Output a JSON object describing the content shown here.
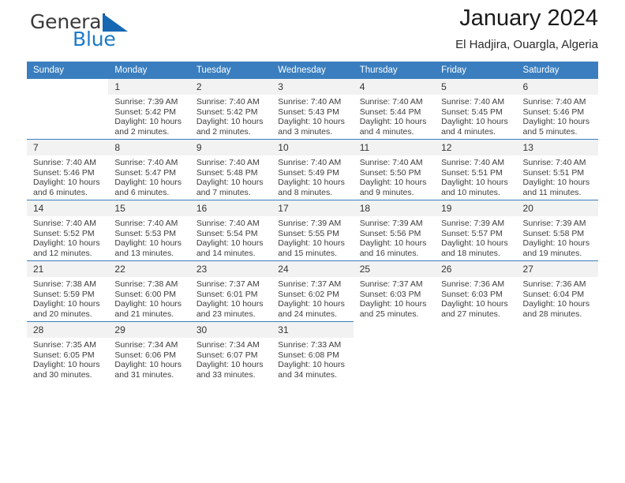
{
  "brand": {
    "word_one": "General",
    "word_two": "Blue",
    "logo_icon": "triangle-flag-icon",
    "accent_color": "#1668b3"
  },
  "header": {
    "title": "January 2024",
    "subtitle": "El Hadjira, Ouargla, Algeria"
  },
  "theme": {
    "header_blue": "#3a7ebf",
    "daynum_gray": "#f2f2f2",
    "text_color": "#3d3d3d"
  },
  "calendar": {
    "weekday_headers": [
      "Sunday",
      "Monday",
      "Tuesday",
      "Wednesday",
      "Thursday",
      "Friday",
      "Saturday"
    ],
    "weeks": [
      [
        {
          "blank": true
        },
        {
          "day": "1",
          "sunrise": "Sunrise: 7:39 AM",
          "sunset": "Sunset: 5:42 PM",
          "daylight": "Daylight: 10 hours and 2 minutes."
        },
        {
          "day": "2",
          "sunrise": "Sunrise: 7:40 AM",
          "sunset": "Sunset: 5:42 PM",
          "daylight": "Daylight: 10 hours and 2 minutes."
        },
        {
          "day": "3",
          "sunrise": "Sunrise: 7:40 AM",
          "sunset": "Sunset: 5:43 PM",
          "daylight": "Daylight: 10 hours and 3 minutes."
        },
        {
          "day": "4",
          "sunrise": "Sunrise: 7:40 AM",
          "sunset": "Sunset: 5:44 PM",
          "daylight": "Daylight: 10 hours and 4 minutes."
        },
        {
          "day": "5",
          "sunrise": "Sunrise: 7:40 AM",
          "sunset": "Sunset: 5:45 PM",
          "daylight": "Daylight: 10 hours and 4 minutes."
        },
        {
          "day": "6",
          "sunrise": "Sunrise: 7:40 AM",
          "sunset": "Sunset: 5:46 PM",
          "daylight": "Daylight: 10 hours and 5 minutes."
        }
      ],
      [
        {
          "day": "7",
          "sunrise": "Sunrise: 7:40 AM",
          "sunset": "Sunset: 5:46 PM",
          "daylight": "Daylight: 10 hours and 6 minutes."
        },
        {
          "day": "8",
          "sunrise": "Sunrise: 7:40 AM",
          "sunset": "Sunset: 5:47 PM",
          "daylight": "Daylight: 10 hours and 6 minutes."
        },
        {
          "day": "9",
          "sunrise": "Sunrise: 7:40 AM",
          "sunset": "Sunset: 5:48 PM",
          "daylight": "Daylight: 10 hours and 7 minutes."
        },
        {
          "day": "10",
          "sunrise": "Sunrise: 7:40 AM",
          "sunset": "Sunset: 5:49 PM",
          "daylight": "Daylight: 10 hours and 8 minutes."
        },
        {
          "day": "11",
          "sunrise": "Sunrise: 7:40 AM",
          "sunset": "Sunset: 5:50 PM",
          "daylight": "Daylight: 10 hours and 9 minutes."
        },
        {
          "day": "12",
          "sunrise": "Sunrise: 7:40 AM",
          "sunset": "Sunset: 5:51 PM",
          "daylight": "Daylight: 10 hours and 10 minutes."
        },
        {
          "day": "13",
          "sunrise": "Sunrise: 7:40 AM",
          "sunset": "Sunset: 5:51 PM",
          "daylight": "Daylight: 10 hours and 11 minutes."
        }
      ],
      [
        {
          "day": "14",
          "sunrise": "Sunrise: 7:40 AM",
          "sunset": "Sunset: 5:52 PM",
          "daylight": "Daylight: 10 hours and 12 minutes."
        },
        {
          "day": "15",
          "sunrise": "Sunrise: 7:40 AM",
          "sunset": "Sunset: 5:53 PM",
          "daylight": "Daylight: 10 hours and 13 minutes."
        },
        {
          "day": "16",
          "sunrise": "Sunrise: 7:40 AM",
          "sunset": "Sunset: 5:54 PM",
          "daylight": "Daylight: 10 hours and 14 minutes."
        },
        {
          "day": "17",
          "sunrise": "Sunrise: 7:39 AM",
          "sunset": "Sunset: 5:55 PM",
          "daylight": "Daylight: 10 hours and 15 minutes."
        },
        {
          "day": "18",
          "sunrise": "Sunrise: 7:39 AM",
          "sunset": "Sunset: 5:56 PM",
          "daylight": "Daylight: 10 hours and 16 minutes."
        },
        {
          "day": "19",
          "sunrise": "Sunrise: 7:39 AM",
          "sunset": "Sunset: 5:57 PM",
          "daylight": "Daylight: 10 hours and 18 minutes."
        },
        {
          "day": "20",
          "sunrise": "Sunrise: 7:39 AM",
          "sunset": "Sunset: 5:58 PM",
          "daylight": "Daylight: 10 hours and 19 minutes."
        }
      ],
      [
        {
          "day": "21",
          "sunrise": "Sunrise: 7:38 AM",
          "sunset": "Sunset: 5:59 PM",
          "daylight": "Daylight: 10 hours and 20 minutes."
        },
        {
          "day": "22",
          "sunrise": "Sunrise: 7:38 AM",
          "sunset": "Sunset: 6:00 PM",
          "daylight": "Daylight: 10 hours and 21 minutes."
        },
        {
          "day": "23",
          "sunrise": "Sunrise: 7:37 AM",
          "sunset": "Sunset: 6:01 PM",
          "daylight": "Daylight: 10 hours and 23 minutes."
        },
        {
          "day": "24",
          "sunrise": "Sunrise: 7:37 AM",
          "sunset": "Sunset: 6:02 PM",
          "daylight": "Daylight: 10 hours and 24 minutes."
        },
        {
          "day": "25",
          "sunrise": "Sunrise: 7:37 AM",
          "sunset": "Sunset: 6:03 PM",
          "daylight": "Daylight: 10 hours and 25 minutes."
        },
        {
          "day": "26",
          "sunrise": "Sunrise: 7:36 AM",
          "sunset": "Sunset: 6:03 PM",
          "daylight": "Daylight: 10 hours and 27 minutes."
        },
        {
          "day": "27",
          "sunrise": "Sunrise: 7:36 AM",
          "sunset": "Sunset: 6:04 PM",
          "daylight": "Daylight: 10 hours and 28 minutes."
        }
      ],
      [
        {
          "day": "28",
          "sunrise": "Sunrise: 7:35 AM",
          "sunset": "Sunset: 6:05 PM",
          "daylight": "Daylight: 10 hours and 30 minutes."
        },
        {
          "day": "29",
          "sunrise": "Sunrise: 7:34 AM",
          "sunset": "Sunset: 6:06 PM",
          "daylight": "Daylight: 10 hours and 31 minutes."
        },
        {
          "day": "30",
          "sunrise": "Sunrise: 7:34 AM",
          "sunset": "Sunset: 6:07 PM",
          "daylight": "Daylight: 10 hours and 33 minutes."
        },
        {
          "day": "31",
          "sunrise": "Sunrise: 7:33 AM",
          "sunset": "Sunset: 6:08 PM",
          "daylight": "Daylight: 10 hours and 34 minutes."
        },
        {
          "blank": true
        },
        {
          "blank": true
        },
        {
          "blank": true
        }
      ]
    ]
  }
}
